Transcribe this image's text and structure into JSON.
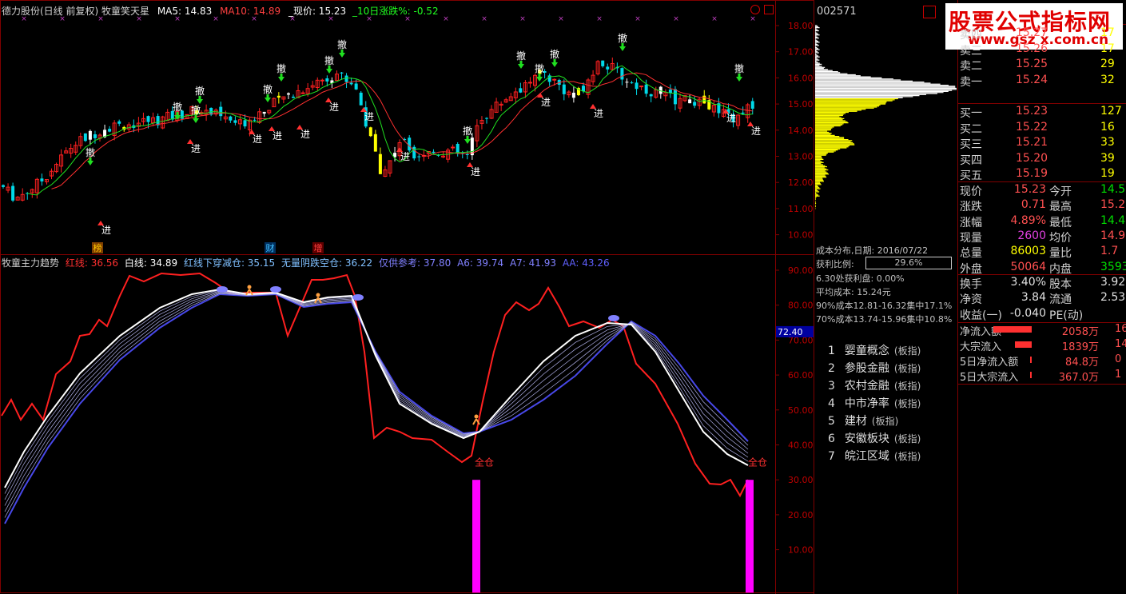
{
  "header": {
    "stock_title": "德力股份(日线 前复权) 牧童笑天星",
    "ma5": "MA5: 14.83",
    "ma10": "MA10: 14.89",
    "price": "_现价: 15.23",
    "chg10": "_10日涨跌%: -0.52"
  },
  "indicator_header": {
    "name": "牧童主力趋势",
    "red": "红线: 36.56",
    "white": "白线: 34.89",
    "cross": "红线下穿减仓: 35.15",
    "noyin": "无量阴跌空仓: 36.22",
    "ref": "仅供参考: 37.80",
    "a6": "A6: 39.74",
    "a7": "A7: 41.93",
    "aa": "AA: 43.26"
  },
  "labels": {
    "che": "撤",
    "jin": "进",
    "bang": "榜",
    "cai": "财",
    "zeng": "增",
    "quancang": "全仓"
  },
  "price_axis": [
    "18.00",
    "17.00",
    "16.00",
    "15.00",
    "14.00",
    "13.00",
    "12.00",
    "11.00",
    "10.00"
  ],
  "ind_axis": [
    "90.00",
    "80.00",
    "70.00",
    "60.00",
    "50.00",
    "40.00",
    "30.00",
    "20.00",
    "10.00"
  ],
  "ind_marker": "72.40",
  "code": "002571",
  "logo": {
    "cn": "股票公式指标网",
    "url": "www.gsz x.com.cn"
  },
  "dist": {
    "title": "成本分布,日期: 2016/07/22",
    "profit_label": "获利比例:",
    "profit_val": "29.6%",
    "l1": "6.30处获利盘: 0.00%",
    "l2": "平均成本: 15.24元",
    "l3": "90%成本12.81-16.32集中17.1%",
    "l4": "70%成本13.74-15.96集中10.8%"
  },
  "blocks": [
    {
      "n": "1",
      "name": "婴童概念",
      "t": "(板指)"
    },
    {
      "n": "2",
      "name": "参股金融",
      "t": "(板指)"
    },
    {
      "n": "3",
      "name": "农村金融",
      "t": "(板指)"
    },
    {
      "n": "4",
      "name": "中市净率",
      "t": "(板指)"
    },
    {
      "n": "5",
      "name": "建材",
      "t": "(板指)"
    },
    {
      "n": "6",
      "name": "安徽板块",
      "t": "(板指)"
    },
    {
      "n": "7",
      "name": "皖江区域",
      "t": "(板指)"
    }
  ],
  "order_book": [
    {
      "l": "卖四",
      "p": "15.27",
      "v": "17"
    },
    {
      "l": "卖三",
      "p": "15.26",
      "v": "17"
    },
    {
      "l": "卖二",
      "p": "15.25",
      "v": "29"
    },
    {
      "l": "卖一",
      "p": "15.24",
      "v": "32"
    },
    {
      "l": "买一",
      "p": "15.23",
      "v": "127"
    },
    {
      "l": "买二",
      "p": "15.22",
      "v": "16"
    },
    {
      "l": "买三",
      "p": "15.21",
      "v": "33"
    },
    {
      "l": "买四",
      "p": "15.20",
      "v": "39"
    },
    {
      "l": "买五",
      "p": "15.19",
      "v": "19"
    }
  ],
  "quote": [
    {
      "a": "现价",
      "av": "15.23",
      "ac": "#ff5050",
      "b": "今开",
      "bv": "14.5",
      "bc": "#00e000"
    },
    {
      "a": "涨跌",
      "av": "0.71",
      "ac": "#ff5050",
      "b": "最高",
      "bv": "15.2",
      "bc": "#ff5050"
    },
    {
      "a": "涨幅",
      "av": "4.89%",
      "ac": "#ff5050",
      "b": "最低",
      "bv": "14.4",
      "bc": "#00e000"
    },
    {
      "a": "现量",
      "av": "2600",
      "ac": "#e040e0",
      "b": "均价",
      "bv": "14.9",
      "bc": "#ff5050"
    },
    {
      "a": "总量",
      "av": "86003",
      "ac": "#ffff00",
      "b": "量比",
      "bv": "1.7",
      "bc": "#ff5050"
    },
    {
      "a": "外盘",
      "av": "50064",
      "ac": "#ff5050",
      "b": "内盘",
      "bv": "3593",
      "bc": "#00e000"
    }
  ],
  "fund": [
    {
      "a": "换手",
      "av": "3.40%",
      "b": "股本",
      "bv": "3.92"
    },
    {
      "a": "净资",
      "av": "3.84",
      "b": "流通",
      "bv": "2.53"
    },
    {
      "a": "收益(一)",
      "av": "-0.040",
      "b": "PE(动)",
      "bv": ""
    }
  ],
  "flow": [
    {
      "l": "净流入额",
      "v": "2058万",
      "r": "16"
    },
    {
      "l": "大宗流入",
      "v": "1839万",
      "r": "14"
    },
    {
      "l": "5日净流入额",
      "v": "84.8万",
      "r": "0"
    },
    {
      "l": "5日大宗流入",
      "v": "367.0万",
      "r": "1"
    }
  ],
  "colors": {
    "red": "#ff2020",
    "white": "#ffffff",
    "blue": "#4848e8",
    "cyan": "#00d8e8",
    "yellow": "#ffff00",
    "magenta": "#ff00ff",
    "grid": "#800000"
  }
}
